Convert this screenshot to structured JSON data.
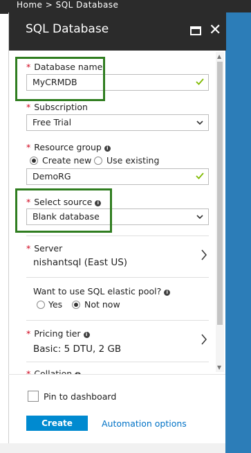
{
  "breadcrumb": {
    "text": "Home > SQL Database"
  },
  "blade": {
    "title": "SQL Database",
    "maximize_icon": "maximize-icon",
    "close_icon": "close-icon"
  },
  "fields": {
    "database_name": {
      "label": "Database name",
      "value": "MyCRMDB",
      "valid": true
    },
    "subscription": {
      "label": "Subscription",
      "value": "Free Trial"
    },
    "resource_group": {
      "label": "Resource group",
      "options": [
        "Create new",
        "Use existing"
      ],
      "selected": "Create new",
      "value": "DemoRG",
      "valid": true
    },
    "select_source": {
      "label": "Select source",
      "value": "Blank database"
    },
    "server": {
      "label": "Server",
      "value": "nishantsql (East US)"
    },
    "elastic_pool": {
      "label": "Want to use SQL elastic pool?",
      "options": [
        "Yes",
        "Not now"
      ],
      "selected": "Not now"
    },
    "pricing_tier": {
      "label": "Pricing tier",
      "value": "Basic: 5 DTU, 2 GB"
    },
    "collation": {
      "label": "Collation"
    }
  },
  "footer": {
    "pin_label": "Pin to dashboard",
    "pin_checked": false,
    "create_label": "Create",
    "automation_label": "Automation options"
  },
  "colors": {
    "header_bg": "#2b2b2b",
    "required": "#d0021b",
    "valid_check": "#7fba00",
    "create_button": "#008ad0",
    "link": "#0072c6",
    "highlight_box": "#2f7d1f",
    "side_panel": "#2c7db8"
  }
}
